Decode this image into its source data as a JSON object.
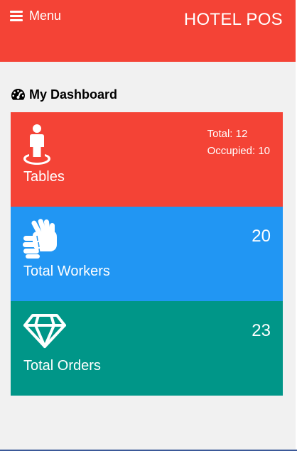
{
  "header": {
    "menu_label": "Menu",
    "brand": "HOTEL POS",
    "background_color": "#f44336"
  },
  "dashboard": {
    "heading": "My Dashboard",
    "heading_icon": "dashboard-gauge-icon"
  },
  "cards": [
    {
      "label": "Tables",
      "icon": "person-on-spot-icon",
      "color": "#f44336",
      "total_text": "Total: 12",
      "occupied_text": "Occupied: 10"
    },
    {
      "label": "Total Workers",
      "icon": "sign-language-hands-icon",
      "color": "#2196f3",
      "value": "20"
    },
    {
      "label": "Total Orders",
      "icon": "diamond-icon",
      "color": "#009688",
      "value": "23"
    }
  ]
}
